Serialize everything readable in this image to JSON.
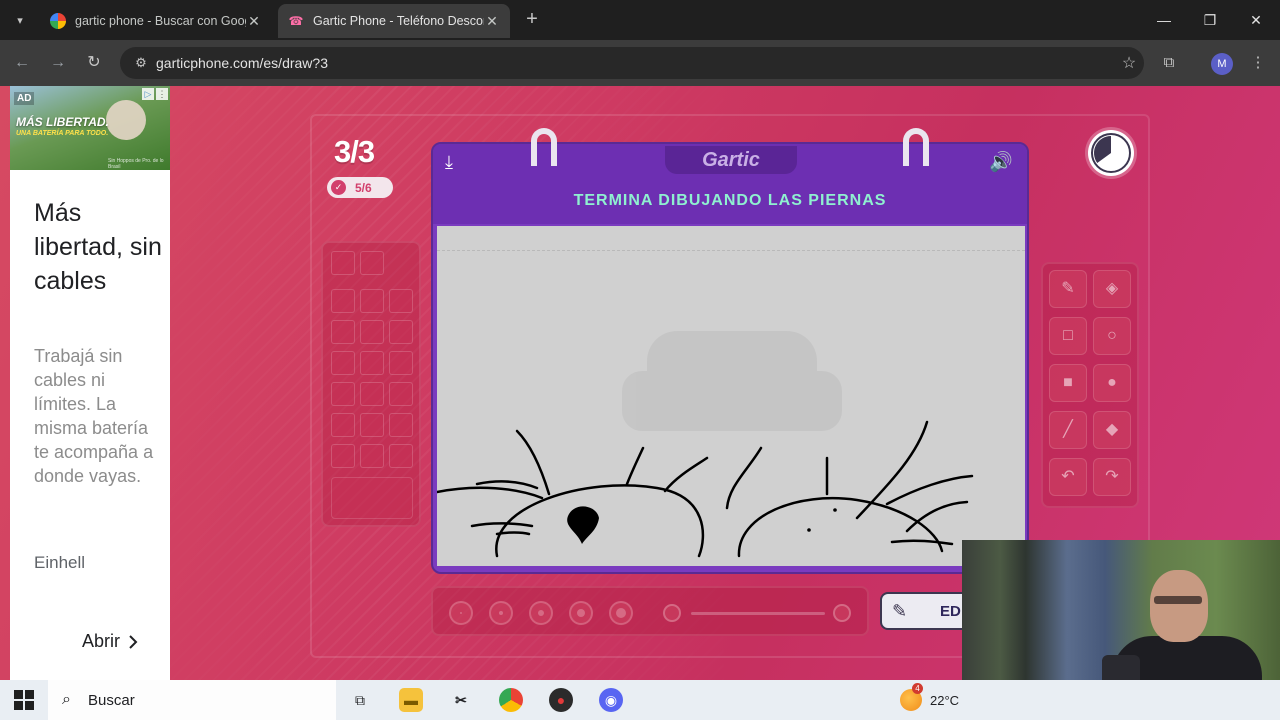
{
  "browser": {
    "tabs": [
      {
        "title": "gartic phone - Buscar con Google",
        "close": "✕"
      },
      {
        "title": "Gartic Phone - Teléfono Descompuesto",
        "close": "✕"
      }
    ],
    "new_tab": "+",
    "url": "garticphone.com/es/draw?3",
    "profile_initial": "M",
    "window_controls": {
      "minimize": "—",
      "maximize": "❐",
      "close": "✕"
    }
  },
  "ad": {
    "tag": "AD",
    "banner_title": "MÁS LIBERTAD.",
    "banner_subtitle": "UNA BATERÍA PARA TODO.",
    "banner_footer": "Sin Hoppos de Pro. de lo Brasil",
    "headline": "Más libertad, sin cables",
    "body": "Trabajá sin cables ni límites. La misma batería te acompaña a donde vayas.",
    "brand": "Einhell",
    "cta": "Abrir",
    "cta_icon": "chevron-right-icon"
  },
  "game": {
    "round": "3/3",
    "players_done": "5/6",
    "logo": "Gartic",
    "prompt": "TERMINA DIBUJANDO LAS PIERNAS",
    "edit_button": "ED",
    "timer_remaining": 0.35,
    "tools": [
      "pencil-icon",
      "eraser-icon",
      "square-outline-icon",
      "circle-outline-icon",
      "square-fill-icon",
      "circle-fill-icon",
      "line-icon",
      "fill-bucket-icon",
      "undo-icon",
      "redo-icon"
    ],
    "brush_sizes": 5
  },
  "taskbar": {
    "search_placeholder": "Buscar",
    "weather_temp": "22°C",
    "weather_badge": "4"
  }
}
